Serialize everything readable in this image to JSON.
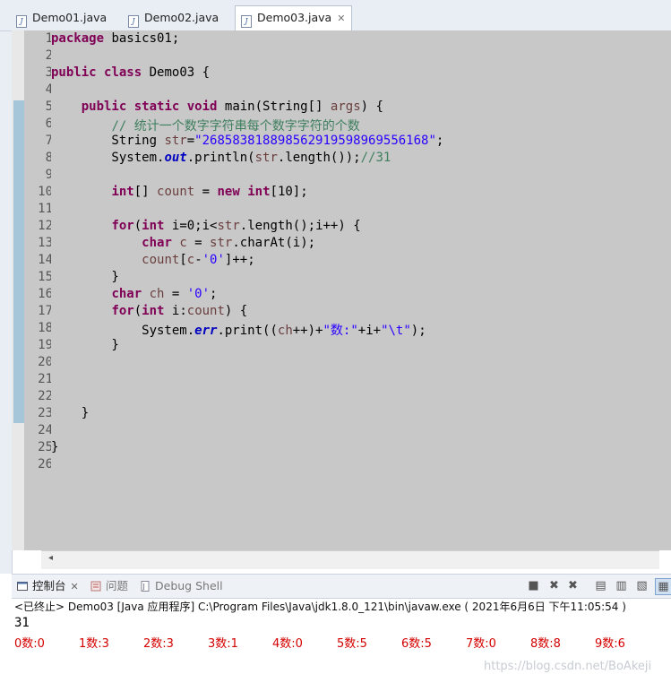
{
  "tabs": [
    {
      "label": "Demo01.java",
      "active": false
    },
    {
      "label": "Demo02.java",
      "active": false
    },
    {
      "label": "Demo03.java",
      "active": true
    }
  ],
  "editor": {
    "line_numbers": [
      "1",
      "2",
      "3",
      "4",
      "5",
      "6",
      "7",
      "8",
      "9",
      "10",
      "11",
      "12",
      "13",
      "14",
      "15",
      "16",
      "17",
      "18",
      "19",
      "20",
      "21",
      "22",
      "23",
      "24",
      "25",
      "26"
    ],
    "lines": [
      "package basics01;",
      "",
      "public class Demo03 {",
      "",
      "    public static void main(String[] args) {",
      "        // 统计一个数字字符串每个数字字符的个数",
      "        String str=\"268583818898562919598969556168\";",
      "        System.out.println(str.length());//31",
      "",
      "        int[] count = new int[10];",
      "",
      "        for(int i=0;i<str.length();i++) {",
      "            char c = str.charAt(i);",
      "            count[c-'0']++;",
      "        }",
      "        char ch = '0';",
      "        for(int i:count) {",
      "            System.err.print((ch++)+\"数:\"+i+\"\\t\");",
      "        }",
      "",
      "",
      "",
      "    }",
      "",
      "}",
      ""
    ]
  },
  "console": {
    "tabs": [
      {
        "label": "控制台",
        "active": true
      },
      {
        "label": "问题",
        "active": false
      },
      {
        "label": "Debug Shell",
        "active": false
      }
    ],
    "status": "<已终止> Demo03 [Java 应用程序] C:\\Program Files\\Java\\jdk1.8.0_121\\bin\\javaw.exe ( 2021年6月6日 下午11:05:54 )",
    "output_line1": "31",
    "output_items": [
      "0数:0",
      "1数:3",
      "2数:3",
      "3数:1",
      "4数:0",
      "5数:5",
      "6数:5",
      "7数:0",
      "8数:8",
      "9数:6"
    ]
  },
  "watermark": "https://blog.csdn.net/BoAkeji"
}
